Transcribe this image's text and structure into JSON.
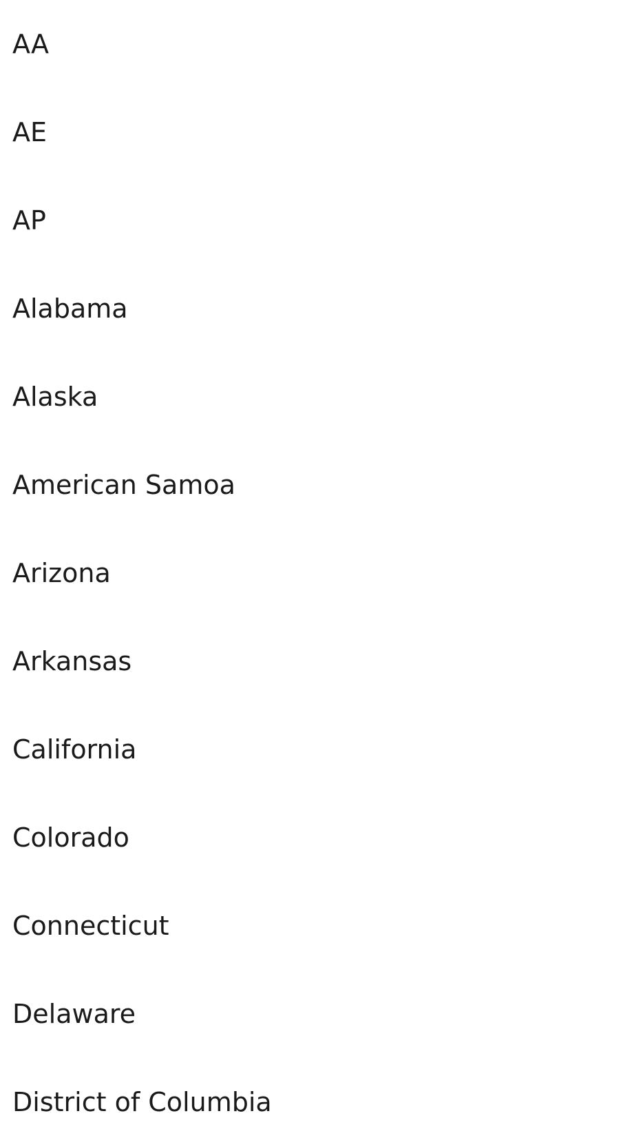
{
  "state_list": {
    "items": [
      {
        "label": "AA"
      },
      {
        "label": "AE"
      },
      {
        "label": "AP"
      },
      {
        "label": "Alabama"
      },
      {
        "label": "Alaska"
      },
      {
        "label": "American Samoa"
      },
      {
        "label": "Arizona"
      },
      {
        "label": "Arkansas"
      },
      {
        "label": "California"
      },
      {
        "label": "Colorado"
      },
      {
        "label": "Connecticut"
      },
      {
        "label": "Delaware"
      },
      {
        "label": "District of Columbia"
      }
    ]
  }
}
